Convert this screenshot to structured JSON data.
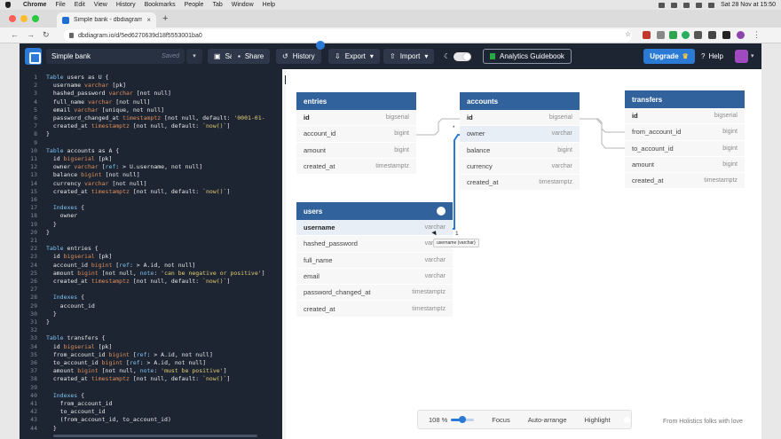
{
  "menubar": {
    "items": [
      "Chrome",
      "File",
      "Edit",
      "View",
      "History",
      "Bookmarks",
      "People",
      "Tab",
      "Window",
      "Help"
    ],
    "clock": "Sat 28 Nov at 15:50"
  },
  "browser": {
    "tab_title": "Simple bank - dbdiagram.io",
    "url": "dbdiagram.io/d/5ed6270639d18f5553001ba0"
  },
  "header": {
    "project_name": "Simple bank",
    "saved_label": "Saved",
    "save_label": "Save",
    "share_label": "Share",
    "history_label": "History",
    "export_label": "Export",
    "import_label": "Import",
    "guide_label": "Analytics Guidebook",
    "upgrade_label": "Upgrade",
    "help_label": "Help"
  },
  "editor": {
    "lines": [
      {
        "n": "1",
        "segs": [
          {
            "c": "kw",
            "t": "Table"
          },
          {
            "c": "",
            "t": " users as U {"
          }
        ]
      },
      {
        "n": "2",
        "segs": [
          {
            "c": "",
            "t": "  username "
          },
          {
            "c": "ty",
            "t": "varchar"
          },
          {
            "c": "",
            "t": " [pk]"
          }
        ]
      },
      {
        "n": "3",
        "segs": [
          {
            "c": "",
            "t": "  hashed_password "
          },
          {
            "c": "ty",
            "t": "varchar"
          },
          {
            "c": "",
            "t": " [not null]"
          }
        ]
      },
      {
        "n": "4",
        "segs": [
          {
            "c": "",
            "t": "  full_name "
          },
          {
            "c": "ty",
            "t": "varchar"
          },
          {
            "c": "",
            "t": " [not null]"
          }
        ]
      },
      {
        "n": "5",
        "segs": [
          {
            "c": "",
            "t": "  email "
          },
          {
            "c": "ty",
            "t": "varchar"
          },
          {
            "c": "",
            "t": " [unique, not null]"
          }
        ]
      },
      {
        "n": "6",
        "segs": [
          {
            "c": "",
            "t": "  password_changed_at "
          },
          {
            "c": "ty",
            "t": "timestamptz"
          },
          {
            "c": "",
            "t": " [not null, default: "
          },
          {
            "c": "st",
            "t": "'0001-01-"
          }
        ]
      },
      {
        "n": "7",
        "segs": [
          {
            "c": "",
            "t": "  created_at "
          },
          {
            "c": "ty",
            "t": "timestamptz"
          },
          {
            "c": "",
            "t": " [not null, default: "
          },
          {
            "c": "st",
            "t": "`now()`"
          },
          {
            "c": "",
            "t": "]"
          }
        ]
      },
      {
        "n": "8",
        "segs": [
          {
            "c": "",
            "t": "}"
          }
        ]
      },
      {
        "n": "9",
        "segs": []
      },
      {
        "n": "10",
        "segs": [
          {
            "c": "kw",
            "t": "Table"
          },
          {
            "c": "",
            "t": " accounts as A {"
          }
        ]
      },
      {
        "n": "11",
        "segs": [
          {
            "c": "",
            "t": "  id "
          },
          {
            "c": "ty",
            "t": "bigserial"
          },
          {
            "c": "",
            "t": " [pk]"
          }
        ]
      },
      {
        "n": "12",
        "segs": [
          {
            "c": "",
            "t": "  owner "
          },
          {
            "c": "ty",
            "t": "varchar"
          },
          {
            "c": "",
            "t": " ["
          },
          {
            "c": "kw",
            "t": "ref"
          },
          {
            "c": "",
            "t": ": > U.username, not null]"
          }
        ]
      },
      {
        "n": "13",
        "segs": [
          {
            "c": "",
            "t": "  balance "
          },
          {
            "c": "ty",
            "t": "bigint"
          },
          {
            "c": "",
            "t": " [not null]"
          }
        ]
      },
      {
        "n": "14",
        "segs": [
          {
            "c": "",
            "t": "  currency "
          },
          {
            "c": "ty",
            "t": "varchar"
          },
          {
            "c": "",
            "t": " [not null]"
          }
        ]
      },
      {
        "n": "15",
        "segs": [
          {
            "c": "",
            "t": "  created_at "
          },
          {
            "c": "ty",
            "t": "timestamptz"
          },
          {
            "c": "",
            "t": " [not null, default: "
          },
          {
            "c": "st",
            "t": "`now()`"
          },
          {
            "c": "",
            "t": "]"
          }
        ]
      },
      {
        "n": "16",
        "segs": []
      },
      {
        "n": "17",
        "segs": [
          {
            "c": "kw",
            "t": "  Indexes"
          },
          {
            "c": "",
            "t": " {"
          }
        ]
      },
      {
        "n": "18",
        "segs": [
          {
            "c": "",
            "t": "    owner"
          }
        ]
      },
      {
        "n": "19",
        "segs": [
          {
            "c": "",
            "t": "  }"
          }
        ]
      },
      {
        "n": "20",
        "segs": [
          {
            "c": "",
            "t": "}"
          }
        ]
      },
      {
        "n": "21",
        "segs": []
      },
      {
        "n": "22",
        "segs": [
          {
            "c": "kw",
            "t": "Table"
          },
          {
            "c": "",
            "t": " entries {"
          }
        ]
      },
      {
        "n": "23",
        "segs": [
          {
            "c": "",
            "t": "  id "
          },
          {
            "c": "ty",
            "t": "bigserial"
          },
          {
            "c": "",
            "t": " [pk]"
          }
        ]
      },
      {
        "n": "24",
        "segs": [
          {
            "c": "",
            "t": "  account_id "
          },
          {
            "c": "ty",
            "t": "bigint"
          },
          {
            "c": "",
            "t": " ["
          },
          {
            "c": "kw",
            "t": "ref"
          },
          {
            "c": "",
            "t": ": > A.id, not null]"
          }
        ]
      },
      {
        "n": "25",
        "segs": [
          {
            "c": "",
            "t": "  amount "
          },
          {
            "c": "ty",
            "t": "bigint"
          },
          {
            "c": "",
            "t": " [not null, "
          },
          {
            "c": "kw",
            "t": "note"
          },
          {
            "c": "",
            "t": ": "
          },
          {
            "c": "st",
            "t": "'can be negative or positive'"
          },
          {
            "c": "",
            "t": "]"
          }
        ]
      },
      {
        "n": "26",
        "segs": [
          {
            "c": "",
            "t": "  created_at "
          },
          {
            "c": "ty",
            "t": "timestamptz"
          },
          {
            "c": "",
            "t": " [not null, default: "
          },
          {
            "c": "st",
            "t": "`now()`"
          },
          {
            "c": "",
            "t": "]"
          }
        ]
      },
      {
        "n": "27",
        "segs": []
      },
      {
        "n": "28",
        "segs": [
          {
            "c": "kw",
            "t": "  Indexes"
          },
          {
            "c": "",
            "t": " {"
          }
        ]
      },
      {
        "n": "29",
        "segs": [
          {
            "c": "",
            "t": "    account_id"
          }
        ]
      },
      {
        "n": "30",
        "segs": [
          {
            "c": "",
            "t": "  }"
          }
        ]
      },
      {
        "n": "31",
        "segs": [
          {
            "c": "",
            "t": "}"
          }
        ]
      },
      {
        "n": "32",
        "segs": []
      },
      {
        "n": "33",
        "segs": [
          {
            "c": "kw",
            "t": "Table"
          },
          {
            "c": "",
            "t": " transfers {"
          }
        ]
      },
      {
        "n": "34",
        "segs": [
          {
            "c": "",
            "t": "  id "
          },
          {
            "c": "ty",
            "t": "bigserial"
          },
          {
            "c": "",
            "t": " [pk]"
          }
        ]
      },
      {
        "n": "35",
        "segs": [
          {
            "c": "",
            "t": "  from_account_id "
          },
          {
            "c": "ty",
            "t": "bigint"
          },
          {
            "c": "",
            "t": " ["
          },
          {
            "c": "kw",
            "t": "ref"
          },
          {
            "c": "",
            "t": ": > A.id, not null]"
          }
        ]
      },
      {
        "n": "36",
        "segs": [
          {
            "c": "",
            "t": "  to_account_id "
          },
          {
            "c": "ty",
            "t": "bigint"
          },
          {
            "c": "",
            "t": " ["
          },
          {
            "c": "kw",
            "t": "ref"
          },
          {
            "c": "",
            "t": ": > A.id, not null]"
          }
        ]
      },
      {
        "n": "37",
        "segs": [
          {
            "c": "",
            "t": "  amount "
          },
          {
            "c": "ty",
            "t": "bigint"
          },
          {
            "c": "",
            "t": " [not null, "
          },
          {
            "c": "kw",
            "t": "note"
          },
          {
            "c": "",
            "t": ": "
          },
          {
            "c": "st",
            "t": "'must be positive'"
          },
          {
            "c": "",
            "t": "]"
          }
        ]
      },
      {
        "n": "38",
        "segs": [
          {
            "c": "",
            "t": "  created_at "
          },
          {
            "c": "ty",
            "t": "timestamptz"
          },
          {
            "c": "",
            "t": " [not null, default: "
          },
          {
            "c": "st",
            "t": "`now()`"
          },
          {
            "c": "",
            "t": "]"
          }
        ]
      },
      {
        "n": "39",
        "segs": []
      },
      {
        "n": "40",
        "segs": [
          {
            "c": "kw",
            "t": "  Indexes"
          },
          {
            "c": "",
            "t": " {"
          }
        ]
      },
      {
        "n": "41",
        "segs": [
          {
            "c": "",
            "t": "    from_account_id"
          }
        ]
      },
      {
        "n": "42",
        "segs": [
          {
            "c": "",
            "t": "    to_account_id"
          }
        ]
      },
      {
        "n": "43",
        "segs": [
          {
            "c": "",
            "t": "    (from_account_id, to_account_id)"
          }
        ]
      },
      {
        "n": "44",
        "segs": [
          {
            "c": "",
            "t": "  }"
          }
        ]
      }
    ]
  },
  "diagram": {
    "tables": {
      "entries": {
        "name": "entries",
        "columns": [
          {
            "name": "id",
            "type": "bigserial",
            "pk": true
          },
          {
            "name": "account_id",
            "type": "bigint"
          },
          {
            "name": "amount",
            "type": "bigint"
          },
          {
            "name": "created_at",
            "type": "timestamptz"
          }
        ]
      },
      "accounts": {
        "name": "accounts",
        "columns": [
          {
            "name": "id",
            "type": "bigserial",
            "pk": true
          },
          {
            "name": "owner",
            "type": "varchar",
            "hl": true
          },
          {
            "name": "balance",
            "type": "bigint"
          },
          {
            "name": "currency",
            "type": "varchar"
          },
          {
            "name": "created_at",
            "type": "timestamptz"
          }
        ]
      },
      "transfers": {
        "name": "transfers",
        "columns": [
          {
            "name": "id",
            "type": "bigserial",
            "pk": true
          },
          {
            "name": "from_account_id",
            "type": "bigint"
          },
          {
            "name": "to_account_id",
            "type": "bigint"
          },
          {
            "name": "amount",
            "type": "bigint"
          },
          {
            "name": "created_at",
            "type": "timestamptz"
          }
        ]
      },
      "users": {
        "name": "users",
        "columns": [
          {
            "name": "username",
            "type": "varchar",
            "pk": true,
            "hl": true
          },
          {
            "name": "hashed_password",
            "type": "varchar"
          },
          {
            "name": "full_name",
            "type": "varchar"
          },
          {
            "name": "email",
            "type": "varchar"
          },
          {
            "name": "password_changed_at",
            "type": "timestamptz"
          },
          {
            "name": "created_at",
            "type": "timestamptz"
          }
        ]
      }
    },
    "cardinality_many": "*",
    "cardinality_one": "1",
    "tooltip": "username (varchar)"
  },
  "toolbar": {
    "zoom": "108 %",
    "focus_label": "Focus",
    "auto_arrange_label": "Auto-arrange",
    "highlight_label": "Highlight",
    "credit": "From Holistics folks with love"
  },
  "colors": {
    "header_bg": "#1d2533",
    "table_header": "#31629b",
    "accent": "#2b7bd6",
    "relation_highlight": "#2b7bd6"
  }
}
